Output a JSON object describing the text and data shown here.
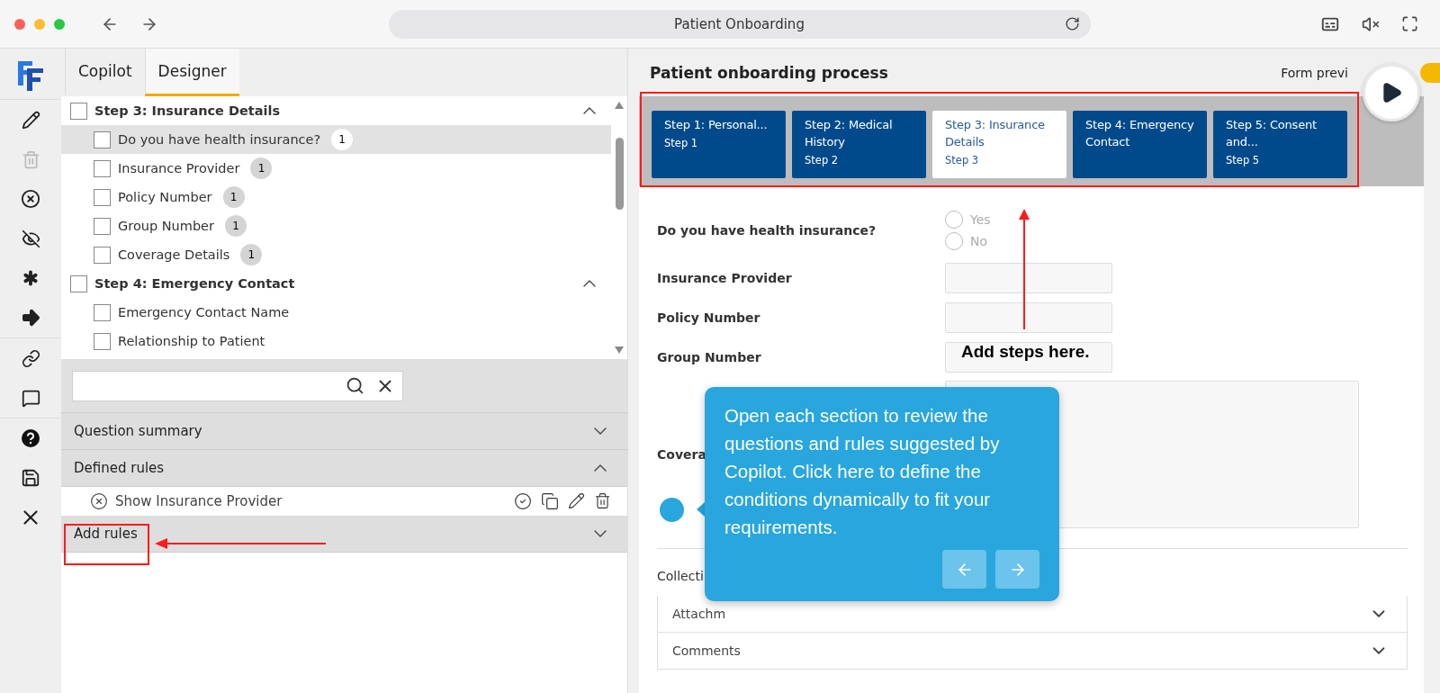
{
  "window": {
    "title": "Patient Onboarding"
  },
  "tabs": [
    {
      "label": "Copilot",
      "selected": false
    },
    {
      "label": "Designer",
      "selected": true
    }
  ],
  "tree": [
    {
      "label": "Step 3: Insurance Details",
      "checked": false,
      "expanded": true,
      "children": [
        {
          "label": "Do you have health insurance?",
          "count": "1",
          "checked": false,
          "selected": true
        },
        {
          "label": "Insurance Provider",
          "count": "1",
          "checked": false,
          "selected": false
        },
        {
          "label": "Policy Number",
          "count": "1",
          "checked": false,
          "selected": false
        },
        {
          "label": "Group Number",
          "count": "1",
          "checked": false,
          "selected": false
        },
        {
          "label": "Coverage Details",
          "count": "1",
          "checked": false,
          "selected": false
        }
      ]
    },
    {
      "label": "Step 4: Emergency Contact",
      "checked": false,
      "expanded": true,
      "children": [
        {
          "label": "Emergency Contact Name",
          "checked": false,
          "selected": false
        },
        {
          "label": "Relationship to Patient",
          "checked": false,
          "selected": false
        }
      ]
    }
  ],
  "sections": [
    {
      "title": "Question summary",
      "expanded": false
    },
    {
      "title": "Defined rules",
      "expanded": true,
      "rules": [
        "Show Insurance Provider"
      ]
    },
    {
      "title": "Add rules",
      "expanded": false
    }
  ],
  "form": {
    "title": "Patient onboarding process",
    "preview_label": "Form previ",
    "preview_on": true,
    "steps": [
      {
        "title": "Step 1: Personal...",
        "sub": "Step 1",
        "selected": false
      },
      {
        "title": "Step 2: Medical History",
        "sub": "Step 2",
        "selected": false
      },
      {
        "title": "Step 3: Insurance Details",
        "sub": "Step 3",
        "selected": true
      },
      {
        "title": "Step 4: Emergency Contact",
        "selected": false
      },
      {
        "title": "Step 5: Consent and...",
        "sub": "Step 5",
        "selected": false
      }
    ],
    "questions": [
      {
        "label": "Do you have health insurance?",
        "kind": "radio",
        "options": [
          {
            "label": "Yes",
            "selected": false
          },
          {
            "label": "No",
            "selected": false
          }
        ]
      },
      {
        "label": "Insurance Provider",
        "kind": "text"
      },
      {
        "label": "Policy Number",
        "kind": "text"
      },
      {
        "label": "Group Number",
        "kind": "text"
      },
      {
        "label": "Covera",
        "kind": "textarea"
      }
    ],
    "collection": {
      "label": "Collecti",
      "panels": [
        {
          "label": "Attachm",
          "expanded": false
        },
        {
          "label": "Comments",
          "expanded": false
        }
      ]
    }
  },
  "tour": {
    "text": "Open each section to review the questions and rules suggested by Copilot. Click here to define the conditions dynamically to fit your requirements."
  },
  "annotations": [
    {
      "text": "Add steps here."
    }
  ]
}
